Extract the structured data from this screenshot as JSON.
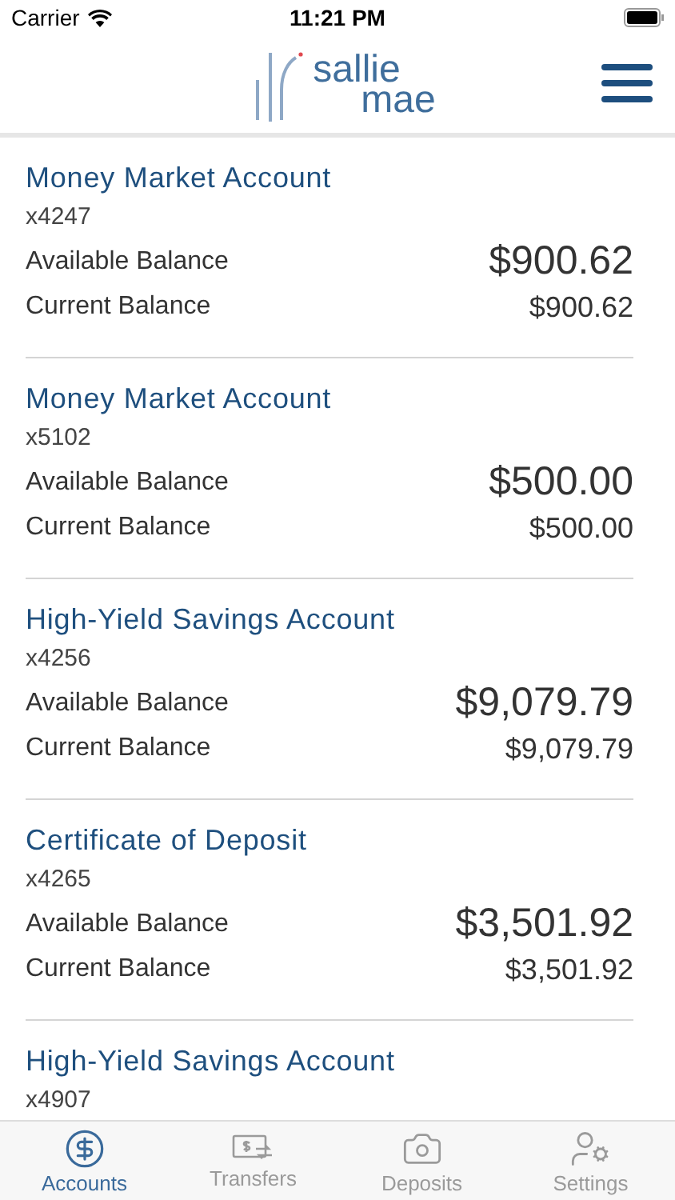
{
  "status_bar": {
    "carrier": "Carrier",
    "time": "11:21 PM"
  },
  "header": {
    "logo_top": "sallie",
    "logo_bottom": "mae"
  },
  "accounts": [
    {
      "name": "Money Market Account",
      "number": "x4247",
      "available_label": "Available Balance",
      "available": "$900.62",
      "current_label": "Current Balance",
      "current": "$900.62"
    },
    {
      "name": "Money Market Account",
      "number": "x5102",
      "available_label": "Available Balance",
      "available": "$500.00",
      "current_label": "Current Balance",
      "current": "$500.00"
    },
    {
      "name": "High-Yield Savings Account",
      "number": "x4256",
      "available_label": "Available Balance",
      "available": "$9,079.79",
      "current_label": "Current Balance",
      "current": "$9,079.79"
    },
    {
      "name": "Certificate of Deposit",
      "number": "x4265",
      "available_label": "Available Balance",
      "available": "$3,501.92",
      "current_label": "Current Balance",
      "current": "$3,501.92"
    },
    {
      "name": "High-Yield Savings Account",
      "number": "x4907"
    }
  ],
  "tab_bar": [
    {
      "kind": "accounts",
      "label": "Accounts",
      "selected": true
    },
    {
      "kind": "transfers",
      "label": "Transfers",
      "selected": false
    },
    {
      "kind": "deposits",
      "label": "Deposits",
      "selected": false
    },
    {
      "kind": "settings",
      "label": "Settings",
      "selected": false
    }
  ]
}
